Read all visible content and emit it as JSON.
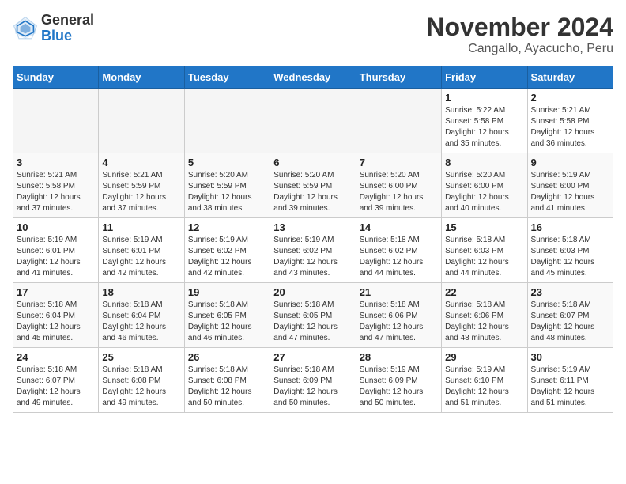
{
  "header": {
    "logo_line1": "General",
    "logo_line2": "Blue",
    "title": "November 2024",
    "subtitle": "Cangallo, Ayacucho, Peru"
  },
  "weekdays": [
    "Sunday",
    "Monday",
    "Tuesday",
    "Wednesday",
    "Thursday",
    "Friday",
    "Saturday"
  ],
  "weeks": [
    [
      {
        "day": "",
        "info": ""
      },
      {
        "day": "",
        "info": ""
      },
      {
        "day": "",
        "info": ""
      },
      {
        "day": "",
        "info": ""
      },
      {
        "day": "",
        "info": ""
      },
      {
        "day": "1",
        "info": "Sunrise: 5:22 AM\nSunset: 5:58 PM\nDaylight: 12 hours\nand 35 minutes."
      },
      {
        "day": "2",
        "info": "Sunrise: 5:21 AM\nSunset: 5:58 PM\nDaylight: 12 hours\nand 36 minutes."
      }
    ],
    [
      {
        "day": "3",
        "info": "Sunrise: 5:21 AM\nSunset: 5:58 PM\nDaylight: 12 hours\nand 37 minutes."
      },
      {
        "day": "4",
        "info": "Sunrise: 5:21 AM\nSunset: 5:59 PM\nDaylight: 12 hours\nand 37 minutes."
      },
      {
        "day": "5",
        "info": "Sunrise: 5:20 AM\nSunset: 5:59 PM\nDaylight: 12 hours\nand 38 minutes."
      },
      {
        "day": "6",
        "info": "Sunrise: 5:20 AM\nSunset: 5:59 PM\nDaylight: 12 hours\nand 39 minutes."
      },
      {
        "day": "7",
        "info": "Sunrise: 5:20 AM\nSunset: 6:00 PM\nDaylight: 12 hours\nand 39 minutes."
      },
      {
        "day": "8",
        "info": "Sunrise: 5:20 AM\nSunset: 6:00 PM\nDaylight: 12 hours\nand 40 minutes."
      },
      {
        "day": "9",
        "info": "Sunrise: 5:19 AM\nSunset: 6:00 PM\nDaylight: 12 hours\nand 41 minutes."
      }
    ],
    [
      {
        "day": "10",
        "info": "Sunrise: 5:19 AM\nSunset: 6:01 PM\nDaylight: 12 hours\nand 41 minutes."
      },
      {
        "day": "11",
        "info": "Sunrise: 5:19 AM\nSunset: 6:01 PM\nDaylight: 12 hours\nand 42 minutes."
      },
      {
        "day": "12",
        "info": "Sunrise: 5:19 AM\nSunset: 6:02 PM\nDaylight: 12 hours\nand 42 minutes."
      },
      {
        "day": "13",
        "info": "Sunrise: 5:19 AM\nSunset: 6:02 PM\nDaylight: 12 hours\nand 43 minutes."
      },
      {
        "day": "14",
        "info": "Sunrise: 5:18 AM\nSunset: 6:02 PM\nDaylight: 12 hours\nand 44 minutes."
      },
      {
        "day": "15",
        "info": "Sunrise: 5:18 AM\nSunset: 6:03 PM\nDaylight: 12 hours\nand 44 minutes."
      },
      {
        "day": "16",
        "info": "Sunrise: 5:18 AM\nSunset: 6:03 PM\nDaylight: 12 hours\nand 45 minutes."
      }
    ],
    [
      {
        "day": "17",
        "info": "Sunrise: 5:18 AM\nSunset: 6:04 PM\nDaylight: 12 hours\nand 45 minutes."
      },
      {
        "day": "18",
        "info": "Sunrise: 5:18 AM\nSunset: 6:04 PM\nDaylight: 12 hours\nand 46 minutes."
      },
      {
        "day": "19",
        "info": "Sunrise: 5:18 AM\nSunset: 6:05 PM\nDaylight: 12 hours\nand 46 minutes."
      },
      {
        "day": "20",
        "info": "Sunrise: 5:18 AM\nSunset: 6:05 PM\nDaylight: 12 hours\nand 47 minutes."
      },
      {
        "day": "21",
        "info": "Sunrise: 5:18 AM\nSunset: 6:06 PM\nDaylight: 12 hours\nand 47 minutes."
      },
      {
        "day": "22",
        "info": "Sunrise: 5:18 AM\nSunset: 6:06 PM\nDaylight: 12 hours\nand 48 minutes."
      },
      {
        "day": "23",
        "info": "Sunrise: 5:18 AM\nSunset: 6:07 PM\nDaylight: 12 hours\nand 48 minutes."
      }
    ],
    [
      {
        "day": "24",
        "info": "Sunrise: 5:18 AM\nSunset: 6:07 PM\nDaylight: 12 hours\nand 49 minutes."
      },
      {
        "day": "25",
        "info": "Sunrise: 5:18 AM\nSunset: 6:08 PM\nDaylight: 12 hours\nand 49 minutes."
      },
      {
        "day": "26",
        "info": "Sunrise: 5:18 AM\nSunset: 6:08 PM\nDaylight: 12 hours\nand 50 minutes."
      },
      {
        "day": "27",
        "info": "Sunrise: 5:18 AM\nSunset: 6:09 PM\nDaylight: 12 hours\nand 50 minutes."
      },
      {
        "day": "28",
        "info": "Sunrise: 5:19 AM\nSunset: 6:09 PM\nDaylight: 12 hours\nand 50 minutes."
      },
      {
        "day": "29",
        "info": "Sunrise: 5:19 AM\nSunset: 6:10 PM\nDaylight: 12 hours\nand 51 minutes."
      },
      {
        "day": "30",
        "info": "Sunrise: 5:19 AM\nSunset: 6:11 PM\nDaylight: 12 hours\nand 51 minutes."
      }
    ]
  ]
}
